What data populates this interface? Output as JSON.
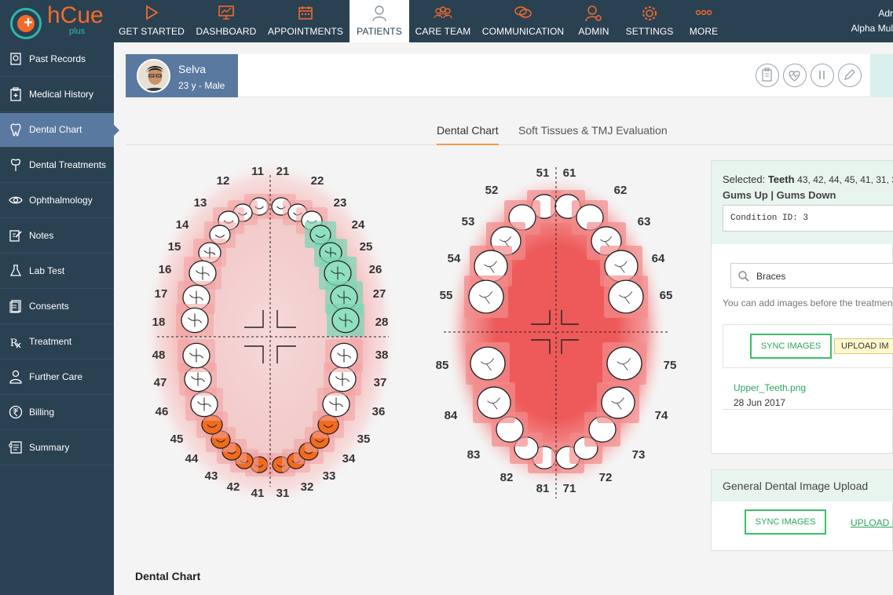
{
  "app": {
    "logo_text": "hCue",
    "logo_sub": "plus"
  },
  "nav": {
    "items": [
      {
        "label": "GET STARTED",
        "icon": "play-icon"
      },
      {
        "label": "DASHBOARD",
        "icon": "presentation-icon"
      },
      {
        "label": "APPOINTMENTS",
        "icon": "calendar-icon"
      },
      {
        "label": "PATIENTS",
        "icon": "person-icon"
      },
      {
        "label": "CARE TEAM",
        "icon": "team-icon"
      },
      {
        "label": "COMMUNICATION",
        "icon": "chat-icon"
      },
      {
        "label": "ADMIN",
        "icon": "admin-icon"
      },
      {
        "label": "SETTINGS",
        "icon": "gear-icon"
      },
      {
        "label": "MORE",
        "icon": "more-icon"
      }
    ],
    "active": "PATIENTS",
    "user_line1": "Adr",
    "user_line2": "Alpha Mul"
  },
  "sidebar": {
    "items": [
      {
        "label": "Past Records",
        "icon": "records-icon"
      },
      {
        "label": "Medical History",
        "icon": "history-icon"
      },
      {
        "label": "Dental Chart",
        "icon": "tooth-icon"
      },
      {
        "label": "Dental Treatments",
        "icon": "dental-treatment-icon"
      },
      {
        "label": "Ophthalmology",
        "icon": "eye-icon"
      },
      {
        "label": "Notes",
        "icon": "notes-icon"
      },
      {
        "label": "Lab Test",
        "icon": "flask-icon"
      },
      {
        "label": "Consents",
        "icon": "consent-icon"
      },
      {
        "label": "Treatment",
        "icon": "rx-icon"
      },
      {
        "label": "Further Care",
        "icon": "care-icon"
      },
      {
        "label": "Billing",
        "icon": "rupee-icon"
      },
      {
        "label": "Summary",
        "icon": "summary-icon"
      }
    ],
    "active": "Dental Chart"
  },
  "patient": {
    "name": "Selva",
    "meta": "23 y - Male"
  },
  "tabs": [
    {
      "label": "Dental Chart"
    },
    {
      "label": "Soft Tissues & TMJ Evaluation"
    }
  ],
  "adult_chart": {
    "upper_left_numbers": [
      "11",
      "12",
      "13",
      "14",
      "15",
      "16",
      "17",
      "18"
    ],
    "upper_right_numbers": [
      "21",
      "22",
      "23",
      "24",
      "25",
      "26",
      "27",
      "28"
    ],
    "lower_left_numbers": [
      "41",
      "42",
      "43",
      "44",
      "45",
      "46",
      "47",
      "48"
    ],
    "lower_right_numbers": [
      "31",
      "32",
      "33",
      "34",
      "35",
      "36",
      "37",
      "38"
    ],
    "selected_green": [
      "24",
      "25",
      "26",
      "27",
      "28"
    ],
    "marked_orange": [
      "31",
      "32",
      "33",
      "34",
      "35",
      "41",
      "42",
      "43",
      "44",
      "45"
    ],
    "colors": {
      "gum": "#f2a0a0",
      "green": "#7dd6b4",
      "orange": "#f26b1d"
    }
  },
  "child_chart": {
    "upper_left_numbers": [
      "51",
      "52",
      "53",
      "54",
      "55"
    ],
    "upper_right_numbers": [
      "61",
      "62",
      "63",
      "64",
      "65"
    ],
    "lower_left_numbers": [
      "81",
      "82",
      "83",
      "84",
      "85"
    ],
    "lower_right_numbers": [
      "71",
      "72",
      "73",
      "74",
      "75"
    ]
  },
  "selection": {
    "prefix": "Selected:",
    "teeth_label": "Teeth",
    "teeth": "43, 42, 44, 45, 41, 31, 3",
    "gums": "Gums Up | Gums Down",
    "condition": "Condition ID: 3"
  },
  "treatment_images": {
    "search_value": "Braces",
    "hint": "You can add images before the treatmen",
    "sync_label": "SYNC IMAGES",
    "upload_label": "UPLOAD IM",
    "file_name": "Upper_Teeth.png",
    "file_date": "28 Jun 2017"
  },
  "general_upload": {
    "title": "General Dental Image Upload",
    "sync_label": "SYNC IMAGES",
    "upload_label": "UPLOAD IM"
  },
  "section_title": "Dental Chart"
}
